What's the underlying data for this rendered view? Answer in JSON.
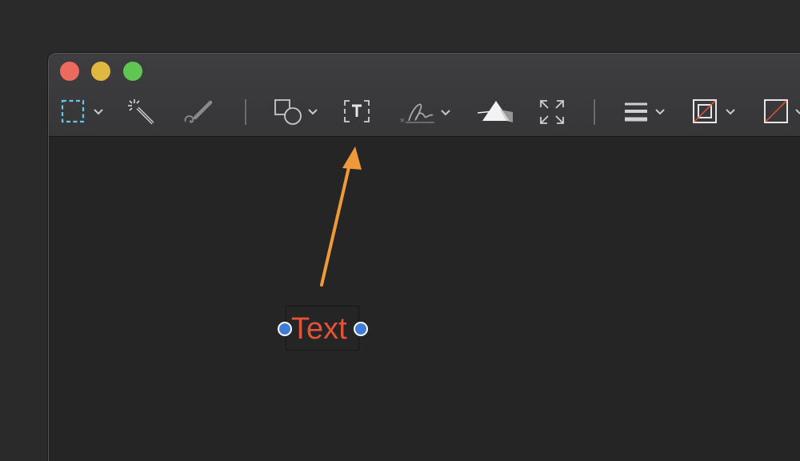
{
  "window": {
    "traffic_lights": [
      "close",
      "minimize",
      "zoom"
    ]
  },
  "toolbar": {
    "tools": [
      {
        "name": "rectangular-selection",
        "has_menu": true
      },
      {
        "name": "instant-alpha",
        "has_menu": false
      },
      {
        "name": "sketch",
        "has_menu": false
      },
      {
        "name": "shapes",
        "has_menu": true
      },
      {
        "name": "text",
        "has_menu": false
      },
      {
        "name": "sign",
        "has_menu": true
      },
      {
        "name": "adjust-color",
        "has_menu": false
      },
      {
        "name": "adjust-size",
        "has_menu": false
      },
      {
        "name": "shape-style",
        "has_menu": true
      },
      {
        "name": "border-color",
        "has_menu": true
      },
      {
        "name": "fill-color",
        "has_menu": true
      }
    ]
  },
  "canvas": {
    "text_annotation": "Text",
    "text_color": "#e5523a",
    "annotation_arrow_color": "#f0993a"
  },
  "colors": {
    "selection_accent": "#63c8e8",
    "handle": "#3f7bd9"
  }
}
